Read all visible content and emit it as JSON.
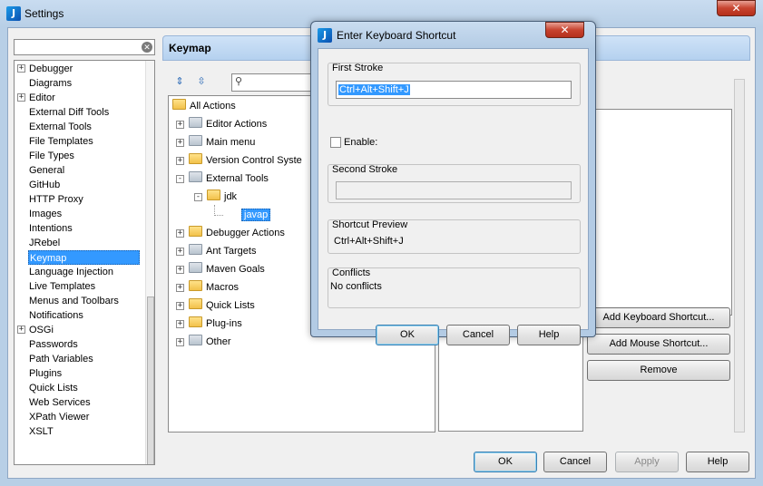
{
  "window": {
    "title": "Settings",
    "close_glyph": "✕"
  },
  "sidebar": {
    "search_value": "",
    "clear_glyph": "✕",
    "items": [
      {
        "label": "Debugger",
        "expandable": true
      },
      {
        "label": "Diagrams",
        "expandable": false
      },
      {
        "label": "Editor",
        "expandable": true
      },
      {
        "label": "External Diff Tools",
        "expandable": false
      },
      {
        "label": "External Tools",
        "expandable": false
      },
      {
        "label": "File Templates",
        "expandable": false
      },
      {
        "label": "File Types",
        "expandable": false
      },
      {
        "label": "General",
        "expandable": false
      },
      {
        "label": "GitHub",
        "expandable": false
      },
      {
        "label": "HTTP Proxy",
        "expandable": false
      },
      {
        "label": "Images",
        "expandable": false
      },
      {
        "label": "Intentions",
        "expandable": false
      },
      {
        "label": "JRebel",
        "expandable": false
      },
      {
        "label": "Keymap",
        "expandable": false,
        "selected": true
      },
      {
        "label": "Language Injection",
        "expandable": false
      },
      {
        "label": "Live Templates",
        "expandable": false
      },
      {
        "label": "Menus and Toolbars",
        "expandable": false
      },
      {
        "label": "Notifications",
        "expandable": false
      },
      {
        "label": "OSGi",
        "expandable": true
      },
      {
        "label": "Passwords",
        "expandable": false
      },
      {
        "label": "Path Variables",
        "expandable": false
      },
      {
        "label": "Plugins",
        "expandable": false
      },
      {
        "label": "Quick Lists",
        "expandable": false
      },
      {
        "label": "Web Services",
        "expandable": false
      },
      {
        "label": "XPath Viewer",
        "expandable": false
      },
      {
        "label": "XSLT",
        "expandable": false
      }
    ]
  },
  "keymap": {
    "header": "Keymap",
    "search_value": "",
    "tree": {
      "root": "All Actions",
      "items": [
        {
          "label": "Editor Actions",
          "icon": "editor-actions-icon"
        },
        {
          "label": "Main menu",
          "icon": "main-menu-icon"
        },
        {
          "label": "Version Control Syste",
          "icon": "folder-icon"
        },
        {
          "label": "External Tools",
          "icon": "external-tools-icon",
          "expanded": true
        },
        {
          "label": "jdk",
          "icon": "folder-icon",
          "expanded": true
        },
        {
          "label": "javap",
          "icon": "",
          "selected": true
        },
        {
          "label": "Debugger Actions",
          "icon": "folder-icon"
        },
        {
          "label": "Ant Targets",
          "icon": "ant-icon"
        },
        {
          "label": "Maven Goals",
          "icon": "maven-icon"
        },
        {
          "label": "Macros",
          "icon": "folder-icon"
        },
        {
          "label": "Quick Lists",
          "icon": "folder-icon"
        },
        {
          "label": "Plug-ins",
          "icon": "folder-icon"
        },
        {
          "label": "Other",
          "icon": "other-icon"
        }
      ]
    },
    "buttons": {
      "add_keyboard": "Add Keyboard Shortcut...",
      "add_mouse": "Add Mouse Shortcut...",
      "remove": "Remove"
    }
  },
  "footer": {
    "ok": "OK",
    "cancel": "Cancel",
    "apply": "Apply",
    "help": "Help"
  },
  "dialog": {
    "title": "Enter Keyboard Shortcut",
    "close_glyph": "✕",
    "first_stroke_caption": "First Stroke",
    "first_stroke_value": "Ctrl+Alt+Shift+J",
    "enable_label": "Enable:",
    "enable_checked": false,
    "second_stroke_caption": "Second Stroke",
    "second_stroke_value": "",
    "preview_caption": "Shortcut Preview",
    "preview_value": "Ctrl+Alt+Shift+J",
    "conflicts_caption": "Conflicts",
    "conflicts_value": "No conflicts",
    "ok": "OK",
    "cancel": "Cancel",
    "help": "Help"
  }
}
